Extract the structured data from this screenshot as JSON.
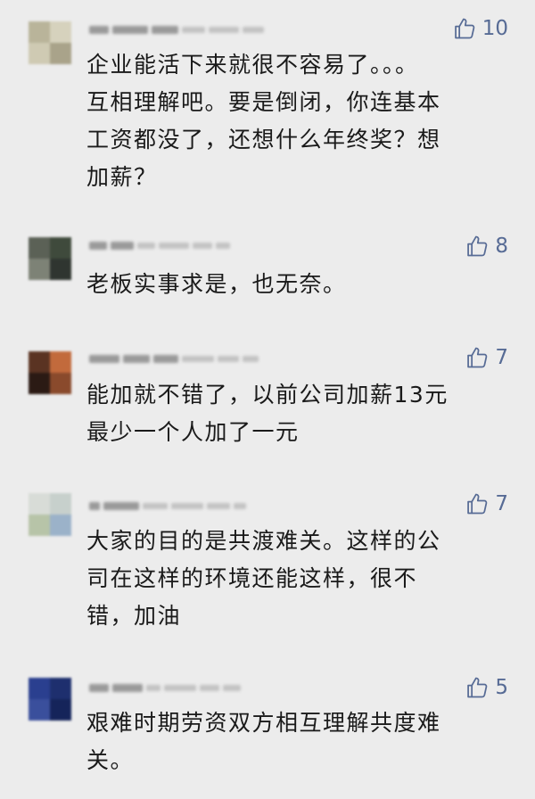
{
  "accent_color": "#576b95",
  "comments": [
    {
      "nickname": "",
      "like_count": "10",
      "like_icon": "thumbs-up-icon",
      "text": "企业能活下来就很不容易了。。。\n互相理解吧。要是倒闭，你连基本\n工资都没了，还想什么年终奖？想\n加薪？"
    },
    {
      "nickname": "",
      "like_count": "8",
      "like_icon": "thumbs-up-icon",
      "text": "老板实事求是，也无奈。"
    },
    {
      "nickname": "",
      "like_count": "7",
      "like_icon": "thumbs-up-icon",
      "text": "能加就不错了，以前公司加薪13元\n最少一个人加了一元"
    },
    {
      "nickname": "",
      "like_count": "7",
      "like_icon": "thumbs-up-icon",
      "text": "大家的目的是共渡难关。这样的公\n司在这样的环境还能这样，很不\n错，加油"
    },
    {
      "nickname": "",
      "like_count": "5",
      "like_icon": "thumbs-up-icon",
      "text": "艰难时期劳资双方相互理解共度难\n关。"
    }
  ]
}
